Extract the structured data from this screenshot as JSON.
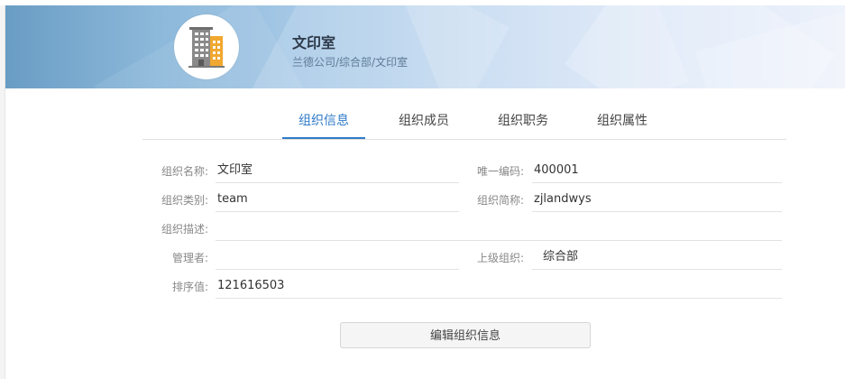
{
  "header": {
    "title": "文印室",
    "path": "兰德公司/综合部/文印室",
    "icon": "building-icon"
  },
  "tabs": [
    {
      "label": "组织信息",
      "active": true
    },
    {
      "label": "组织成员",
      "active": false
    },
    {
      "label": "组织职务",
      "active": false
    },
    {
      "label": "组织属性",
      "active": false
    }
  ],
  "fields": {
    "name": {
      "label": "组织名称:",
      "value": "文印室"
    },
    "code": {
      "label": "唯一编码:",
      "value": "400001"
    },
    "type": {
      "label": "组织类别:",
      "value": "team"
    },
    "short_name": {
      "label": "组织简称:",
      "value": "zjlandwys"
    },
    "description": {
      "label": "组织描述:",
      "value": ""
    },
    "manager": {
      "label": "管理者:",
      "value": ""
    },
    "parent": {
      "label": "上级组织:",
      "value": "综合部"
    },
    "sort": {
      "label": "排序值:",
      "value": "121616503"
    }
  },
  "actions": {
    "edit_label": "编辑组织信息"
  },
  "colors": {
    "accent": "#2f7bc8",
    "building_gray": "#8a8a8a",
    "building_orange": "#f0a830"
  }
}
